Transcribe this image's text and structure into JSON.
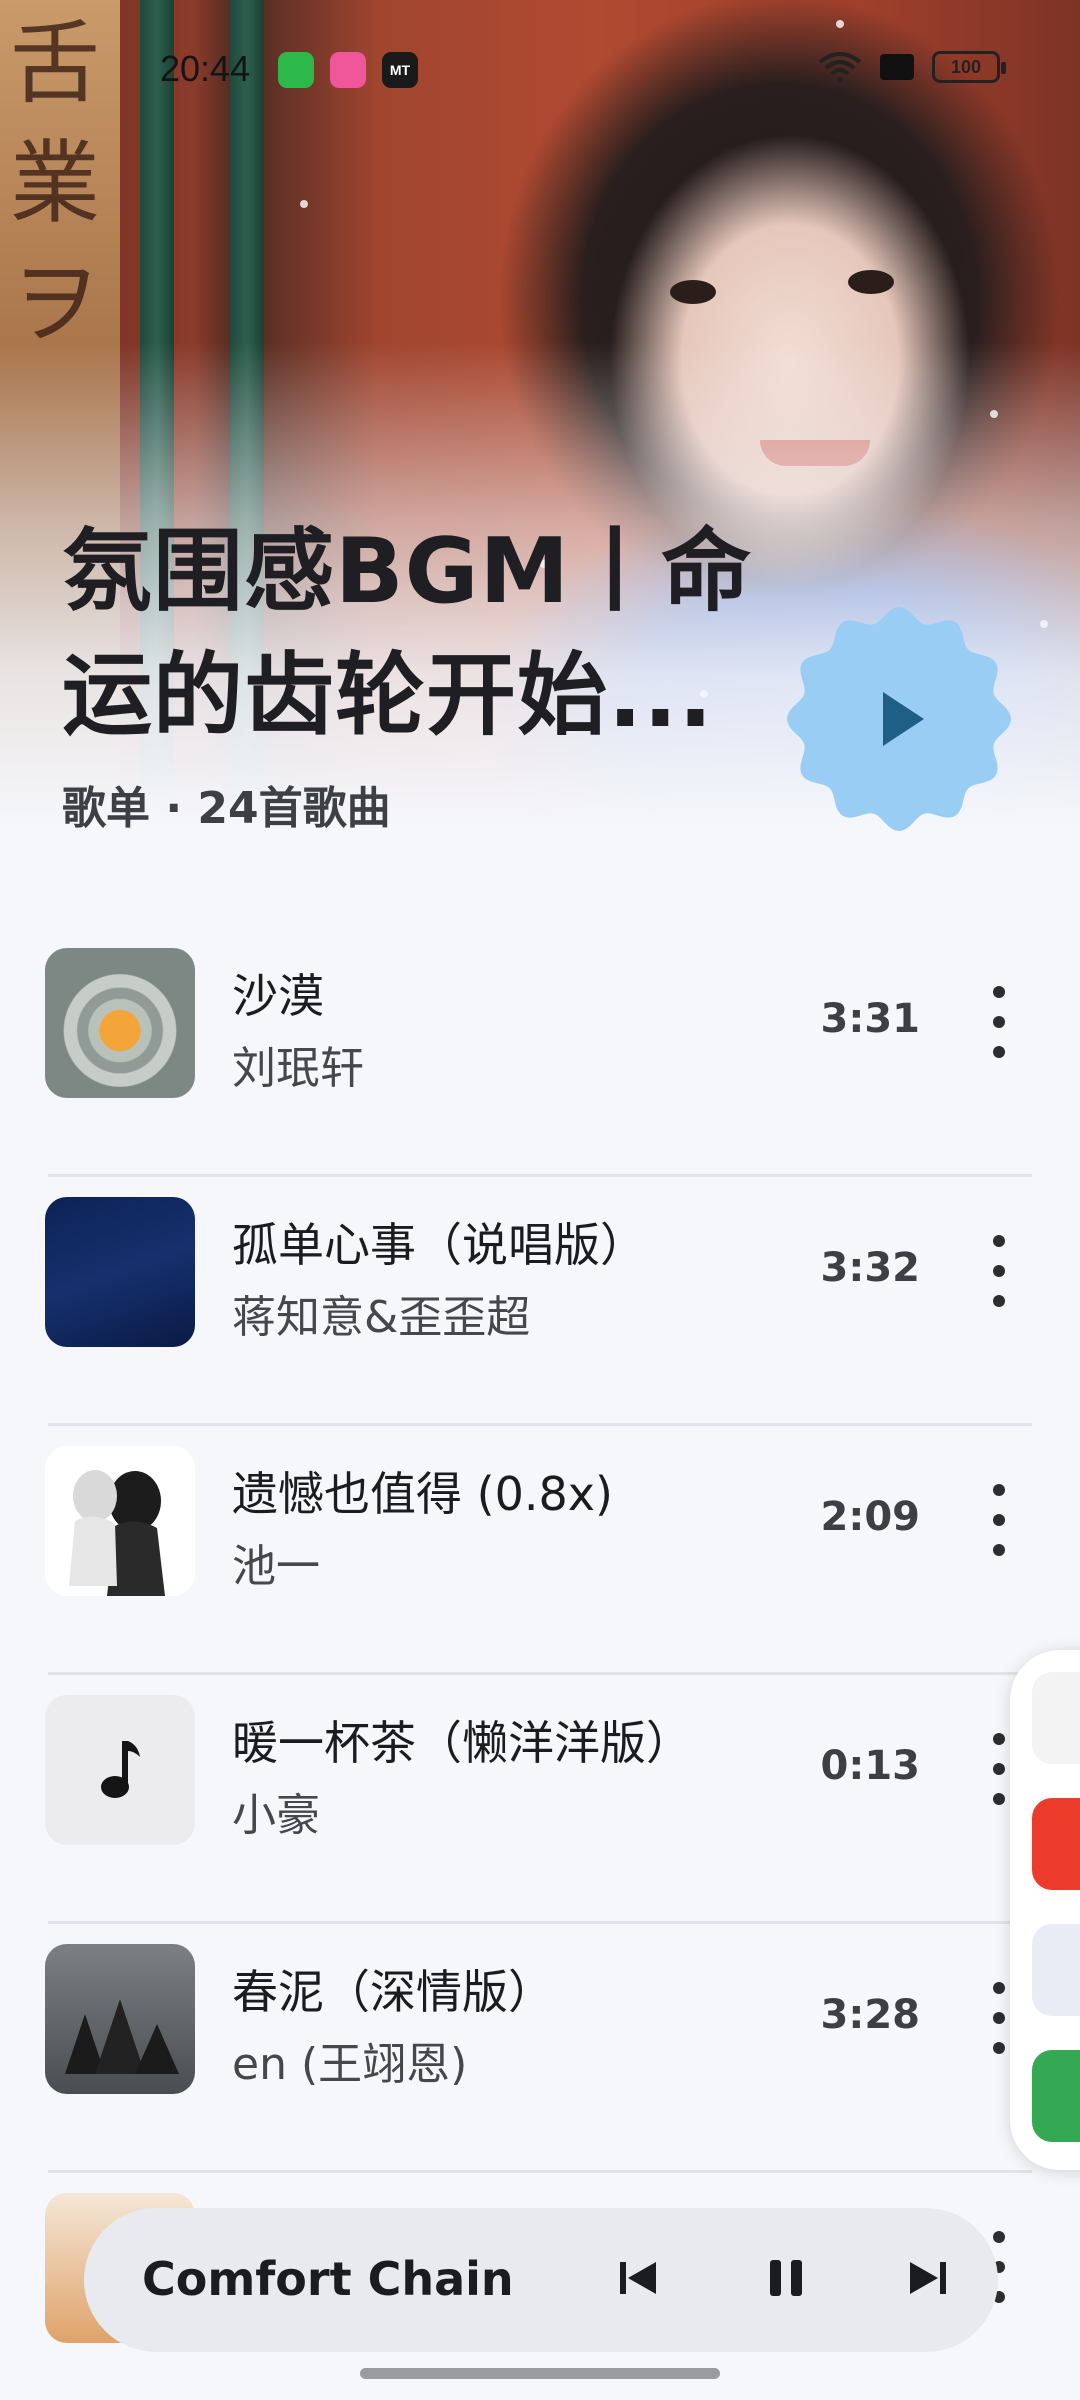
{
  "status_bar": {
    "time": "20:44",
    "mt_label": "MT",
    "battery": "100"
  },
  "playlist": {
    "title": "氛围感BGM丨命运的齿轮开始...",
    "subtitle": "歌单 · 24首歌曲"
  },
  "songs": [
    {
      "title": "沙漠",
      "artist": "刘珉轩",
      "duration": "3:31"
    },
    {
      "title": "孤单心事（说唱版）",
      "artist": "蒋知意&歪歪超",
      "duration": "3:32"
    },
    {
      "title": "遗憾也值得 (0.8x)",
      "artist": "池一",
      "duration": "2:09"
    },
    {
      "title": "暖一杯茶（懒洋洋版）",
      "artist": "小豪",
      "duration": "0:13"
    },
    {
      "title": "春泥（深情版）",
      "artist": "en (王翊恩)",
      "duration": "3:28"
    }
  ],
  "mini_player": {
    "track": "Comfort Chain"
  },
  "colors": {
    "accent_fab": "#99cdf4",
    "play_glyph": "#1f5f86",
    "background": "#f6f7fb"
  },
  "icons": {
    "play": "play-icon",
    "more": "more-vertical-icon",
    "prev": "skip-previous-icon",
    "pause": "pause-icon",
    "next": "skip-next-icon",
    "music_note": "music-note-icon"
  }
}
